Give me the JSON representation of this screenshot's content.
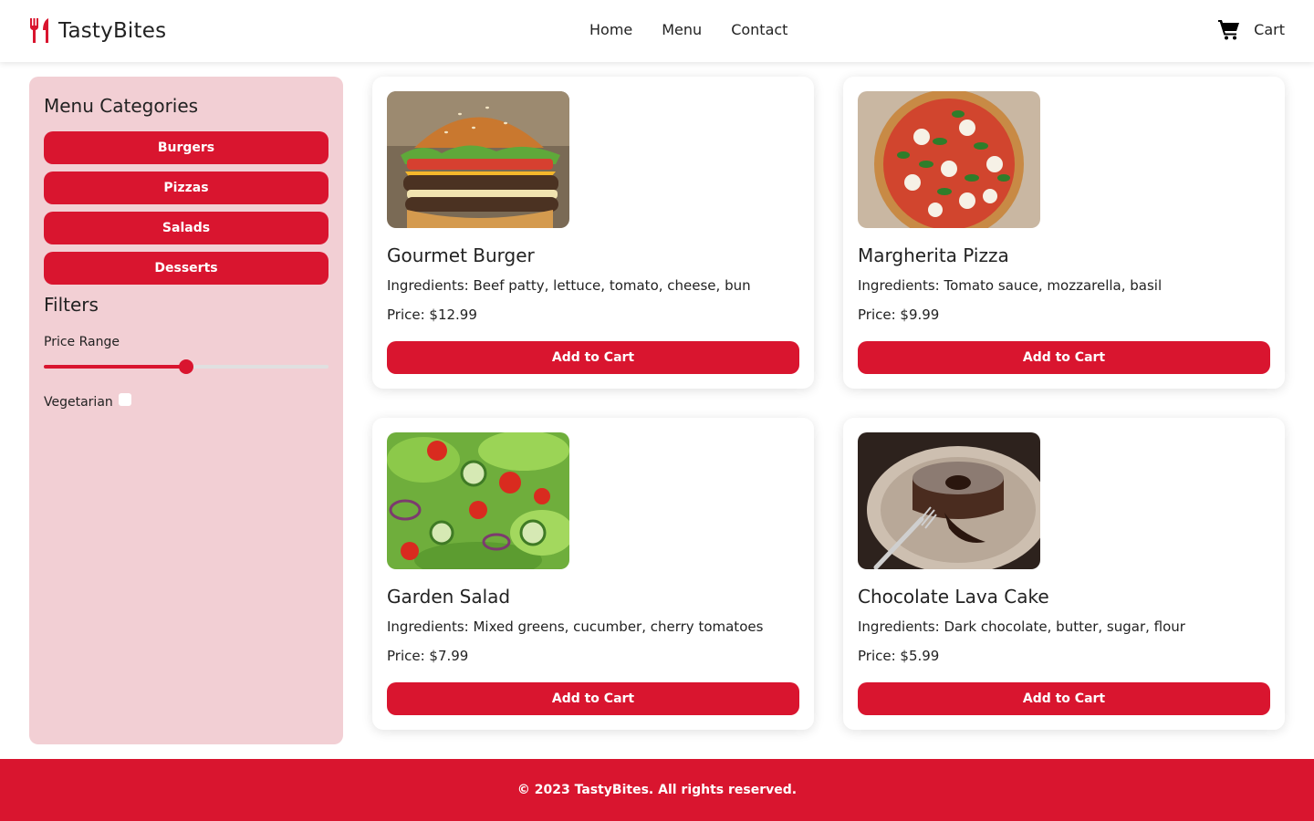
{
  "brand": {
    "name": "TastyBites",
    "icon": "utensils-icon"
  },
  "nav": {
    "items": [
      "Home",
      "Menu",
      "Contact"
    ]
  },
  "cart": {
    "label": "Cart",
    "icon": "shopping-cart-icon"
  },
  "sidebar": {
    "title": "Menu Categories",
    "categories": [
      "Burgers",
      "Pizzas",
      "Salads",
      "Desserts"
    ],
    "filters_title": "Filters",
    "price_range": {
      "label": "Price Range",
      "value_fraction": 0.5
    },
    "vegetarian": {
      "label": "Vegetarian",
      "checked": false
    }
  },
  "products": [
    {
      "name": "Gourmet Burger",
      "ingredients": "Ingredients: Beef patty, lettuce, tomato, cheese, bun",
      "price": "Price: $12.99",
      "button": "Add to Cart",
      "image": "burger-photo"
    },
    {
      "name": "Margherita Pizza",
      "ingredients": "Ingredients: Tomato sauce, mozzarella, basil",
      "price": "Price: $9.99",
      "button": "Add to Cart",
      "image": "pizza-photo"
    },
    {
      "name": "Garden Salad",
      "ingredients": "Ingredients: Mixed greens, cucumber, cherry tomatoes",
      "price": "Price: $7.99",
      "button": "Add to Cart",
      "image": "salad-photo"
    },
    {
      "name": "Chocolate Lava Cake",
      "ingredients": "Ingredients: Dark chocolate, butter, sugar, flour",
      "price": "Price: $5.99",
      "button": "Add to Cart",
      "image": "lava-cake-photo"
    }
  ],
  "footer": {
    "text": "© 2023 TastyBites. All rights reserved."
  },
  "colors": {
    "accent": "#d9152f",
    "sidebar_bg": "#f2cfd4"
  }
}
